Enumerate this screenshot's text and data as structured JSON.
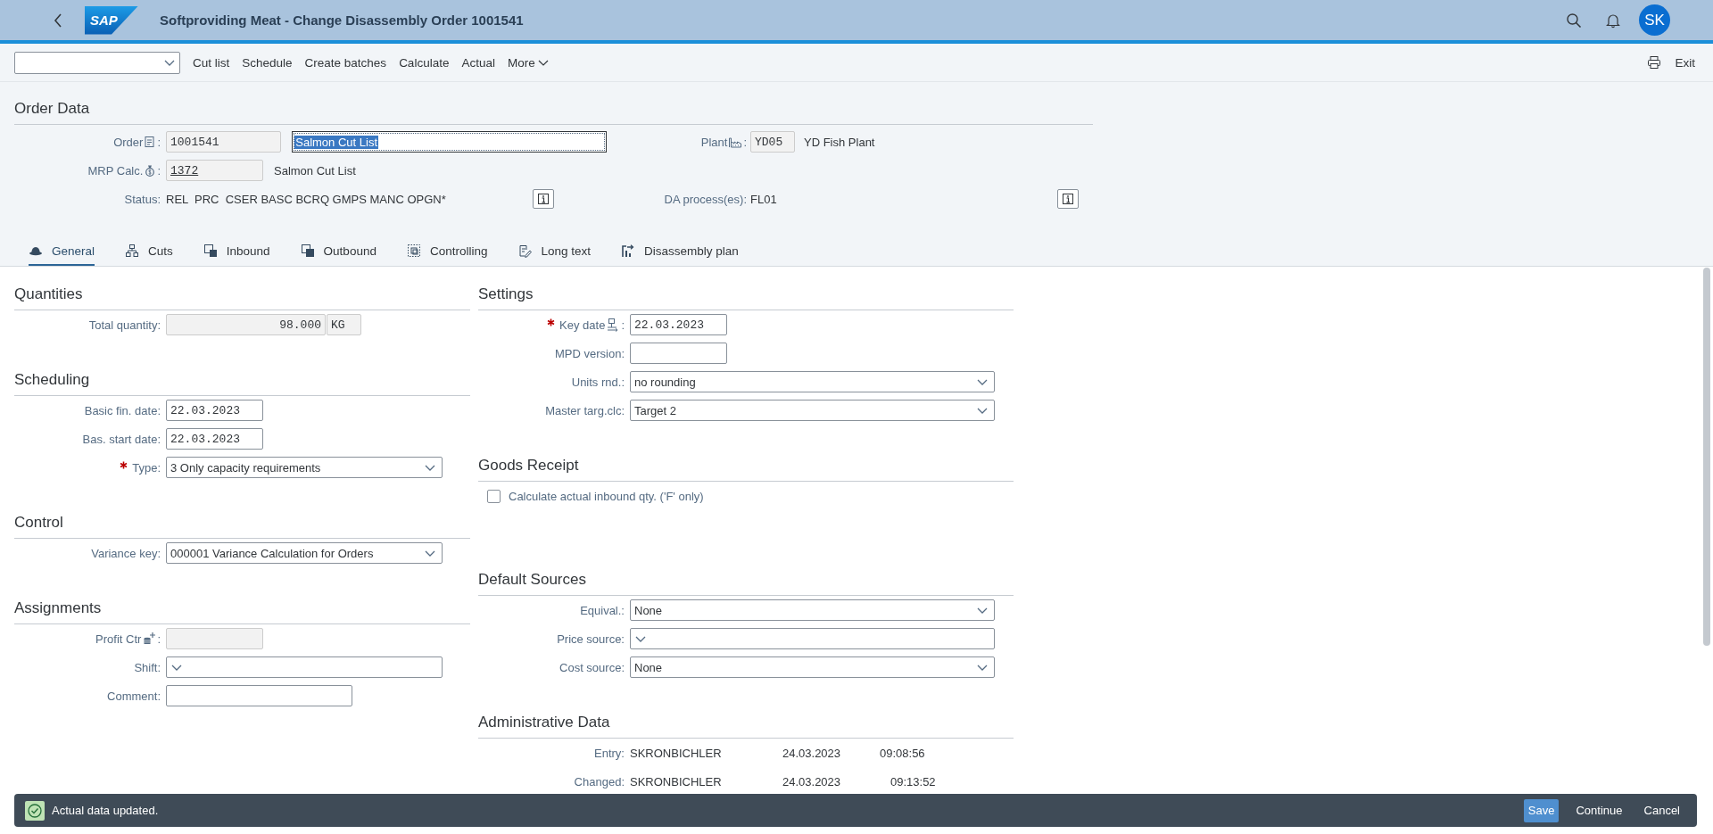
{
  "shell": {
    "logo": "SAP",
    "title": "Softproviding Meat - Change Disassembly Order 1001541",
    "avatar": "SK"
  },
  "toolbar": {
    "actions": [
      {
        "label": "Cut list",
        "menu": false
      },
      {
        "label": "Schedule",
        "menu": false
      },
      {
        "label": "Create batches",
        "menu": false
      },
      {
        "label": "Calculate",
        "menu": false
      },
      {
        "label": "Actual",
        "menu": false
      },
      {
        "label": "More",
        "menu": true
      }
    ],
    "exit": "Exit"
  },
  "order_data": {
    "title": "Order Data",
    "order": {
      "label": "Order",
      "colon": ":",
      "value": "1001541",
      "readonly": true,
      "link": false,
      "description": {
        "value": "Salmon Cut List",
        "selected": true
      }
    },
    "plant": {
      "label": "Plant",
      "colon": ":",
      "value": "YD05",
      "readonly": true,
      "description": "YD Fish Plant"
    },
    "mrp": {
      "label": "MRP Calc.",
      "colon": ":",
      "value": "1372",
      "readonly": true,
      "link": true,
      "description": "Salmon Cut List"
    },
    "status": {
      "label": "Status:",
      "value": "REL  PRC  CSER BASC BCRQ GMPS MANC OPGN*"
    },
    "da_process": {
      "label": "DA process(es):",
      "value": "FL01"
    }
  },
  "tabs": [
    {
      "label": "General",
      "selected": true
    },
    {
      "label": "Cuts",
      "selected": false
    },
    {
      "label": "Inbound",
      "selected": false
    },
    {
      "label": "Outbound",
      "selected": false
    },
    {
      "label": "Controlling",
      "selected": false
    },
    {
      "label": "Long text",
      "selected": false
    },
    {
      "label": "Disassembly plan",
      "selected": false
    }
  ],
  "columns": [
    [
      {
        "title": "Quantities",
        "items": [
          {
            "kind": "quantity",
            "label": "Total quantity:",
            "value": "98.000",
            "unit": "KG",
            "readonly": true,
            "required": false
          }
        ]
      },
      {
        "title": "Scheduling",
        "items": [
          {
            "kind": "input",
            "label": "Basic fin. date:",
            "value": "22.03.2023",
            "readonly": false,
            "required": false
          },
          {
            "kind": "input",
            "label": "Bas. start date:",
            "value": "22.03.2023",
            "readonly": false,
            "required": false
          },
          {
            "kind": "select",
            "label": "Type:",
            "value": "3 Only capacity requirements",
            "required": true
          }
        ]
      },
      {
        "title": "Control",
        "items": [
          {
            "kind": "select",
            "label": "Variance key:",
            "value": "000001 Variance Calculation for Orders",
            "required": false
          }
        ]
      },
      {
        "title": "Assignments",
        "items": [
          {
            "kind": "input",
            "label": "Profit Ctr",
            "colon": ":",
            "readonly": true,
            "required": false
          },
          {
            "kind": "select",
            "label": "Shift:",
            "required": false
          },
          {
            "kind": "input",
            "label": "Comment:",
            "readonly": false,
            "required": false
          }
        ]
      }
    ],
    [
      {
        "title": "Settings",
        "items": [
          {
            "kind": "input",
            "label": "Key date",
            "colon": ":",
            "value": "22.03.2023",
            "readonly": false,
            "required": true
          },
          {
            "kind": "input",
            "label": "MPD version:",
            "readonly": false,
            "required": false
          },
          {
            "kind": "select",
            "label": "Units rnd.:",
            "value": "no rounding",
            "required": false
          },
          {
            "kind": "select",
            "label": "Master targ.clc:",
            "value": "Target 2",
            "required": false
          }
        ]
      },
      {
        "title": "Goods Receipt",
        "items": [
          {
            "kind": "checkbox",
            "label": "Calculate actual inbound qty. ('F' only)",
            "checked": false
          }
        ]
      },
      {
        "title": "Default Sources",
        "items": [
          {
            "kind": "select",
            "label": "Equival.:",
            "value": "None",
            "required": false
          },
          {
            "kind": "select",
            "label": "Price source:",
            "required": false
          },
          {
            "kind": "select",
            "label": "Cost source:",
            "value": "None",
            "required": false
          }
        ]
      },
      {
        "title": "Administrative Data",
        "items": [
          {
            "kind": "admin",
            "label": "Entry:",
            "user": "SKRONBICHLER",
            "date": "24.03.2023",
            "time": "09:08:56"
          },
          {
            "kind": "admin",
            "label": "Changed:",
            "user": "SKRONBICHLER",
            "date": "24.03.2023",
            "time": "09:13:52"
          }
        ]
      }
    ]
  ],
  "message": {
    "text": "Actual data updated."
  },
  "footer_buttons": [
    {
      "label": "Save",
      "emphasized": true
    },
    {
      "label": "Continue",
      "emphasized": false
    },
    {
      "label": "Cancel",
      "emphasized": false
    }
  ]
}
